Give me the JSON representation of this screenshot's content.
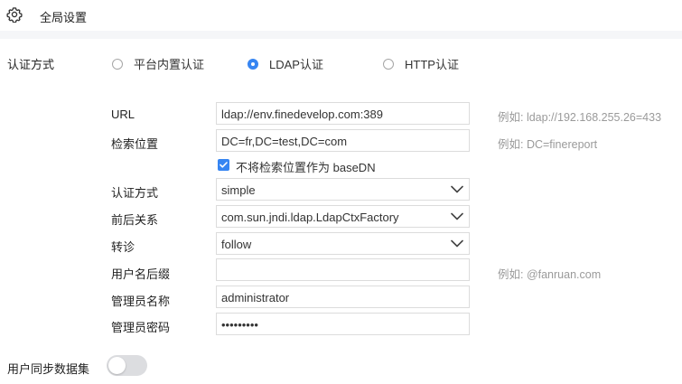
{
  "header": {
    "title": "全局设置",
    "icon": "gear-icon"
  },
  "auth": {
    "label": "认证方式",
    "options": [
      {
        "label": "平台内置认证",
        "checked": false
      },
      {
        "label": "LDAP认证",
        "checked": true
      },
      {
        "label": "HTTP认证",
        "checked": false
      }
    ]
  },
  "ldap": {
    "url": {
      "label": "URL",
      "value": "ldap://env.finedevelop.com:389",
      "hint": "例如: ldap://192.168.255.26=433"
    },
    "search": {
      "label": "检索位置",
      "value": "DC=fr,DC=test,DC=com",
      "hint": "例如: DC=finereport"
    },
    "no_basedn": {
      "label": "不将检索位置作为 baseDN",
      "checked": true
    },
    "auth_method": {
      "label": "认证方式",
      "value": "simple"
    },
    "context": {
      "label": "前后关系",
      "value": "com.sun.jndi.ldap.LdapCtxFactory"
    },
    "referral": {
      "label": "转诊",
      "value": "follow"
    },
    "suffix": {
      "label": "用户名后缀",
      "value": "",
      "hint": "例如: @fanruan.com"
    },
    "admin_name": {
      "label": "管理员名称",
      "value": "administrator"
    },
    "admin_password": {
      "label": "管理员密码",
      "value": "•••••••••"
    }
  },
  "sync": {
    "label": "用户同步数据集",
    "enabled": false
  },
  "colors": {
    "accent": "#3685f2",
    "divider": "#f5f6f8",
    "hint": "#9a9a9a"
  }
}
